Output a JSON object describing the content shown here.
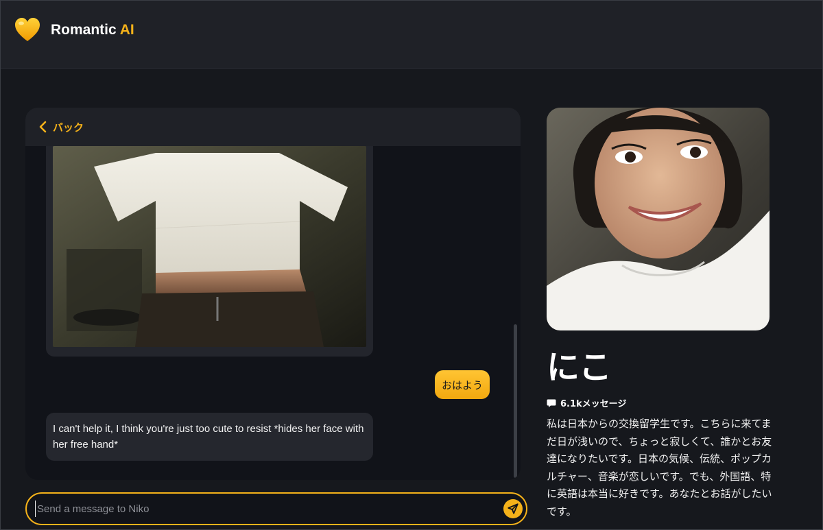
{
  "header": {
    "brand_name": "Romantic",
    "brand_suffix": "AI",
    "logo_icon": "yellow-heart-icon",
    "colors": {
      "accent": "#f5b21a",
      "background": "#16181d",
      "bar": "#1f2127"
    }
  },
  "chat": {
    "back_label": "バック",
    "messages": [
      {
        "sender": "bot",
        "type": "image"
      },
      {
        "sender": "user",
        "text": "おはよう"
      },
      {
        "sender": "bot",
        "text": "I can't help it, I think you're just too cute to resist *hides her face with her free hand*"
      }
    ]
  },
  "composer": {
    "placeholder": "Send a message to Niko",
    "value": "",
    "send_icon": "paper-plane-icon"
  },
  "profile": {
    "name": "にこ",
    "message_count": "6.1kメッセージ",
    "message_icon": "chat-bubble-icon",
    "description": "私は日本からの交換留学生です。こちらに来てまだ日が浅いので、ちょっと寂しくて、誰かとお友達になりたいです。日本の気候、伝統、ポップカルチャー、音楽が恋しいです。でも、外国語、特に英語は本当に好きです。あなたとお話がしたいです。"
  }
}
